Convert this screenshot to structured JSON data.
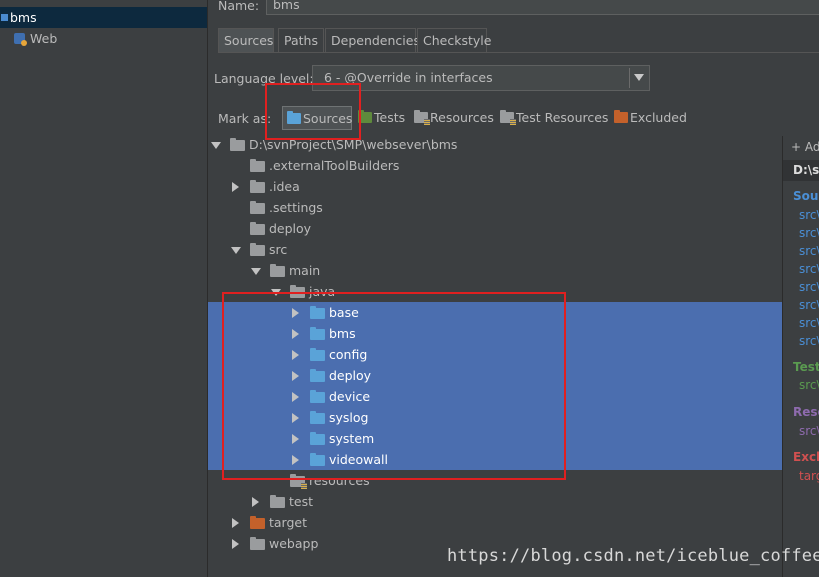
{
  "modules": {
    "items": [
      {
        "label": "bms",
        "selected": true
      },
      {
        "label": "Web",
        "selected": false
      }
    ]
  },
  "header": {
    "name_label": "Name:",
    "name_value": "bms"
  },
  "tabs": [
    {
      "label": "Sources",
      "active": true
    },
    {
      "label": "Paths",
      "active": false
    },
    {
      "label": "Dependencies",
      "active": false
    },
    {
      "label": "Checkstyle",
      "active": false
    }
  ],
  "language": {
    "label": "Language level:",
    "value": "6 - @Override in interfaces"
  },
  "mark_as": {
    "label": "Mark as:",
    "buttons": [
      {
        "label": "Sources",
        "color": "#5aa3d8"
      },
      {
        "label": "Tests",
        "color": "#5e8a3c"
      },
      {
        "label": "Resources",
        "color": "#9a9c9e"
      },
      {
        "label": "Test Resources",
        "color": "#9a9c9e"
      },
      {
        "label": "Excluded",
        "color": "#c4612b"
      }
    ]
  },
  "tree": {
    "root": "D:\\svnProject\\SMP\\websever\\bms",
    "items": [
      {
        "label": ".externalToolBuilders"
      },
      {
        "label": ".idea"
      },
      {
        "label": ".settings"
      },
      {
        "label": "deploy"
      },
      {
        "label": "src"
      },
      {
        "label": "main"
      },
      {
        "label": "java"
      },
      {
        "label": "base"
      },
      {
        "label": "bms"
      },
      {
        "label": "config"
      },
      {
        "label": "deploy"
      },
      {
        "label": "device"
      },
      {
        "label": "syslog"
      },
      {
        "label": "system"
      },
      {
        "label": "videowall"
      },
      {
        "label": "resources"
      },
      {
        "label": "test"
      },
      {
        "label": "target"
      },
      {
        "label": "webapp"
      }
    ]
  },
  "roots": {
    "add": "+ Ad",
    "path": "D:\\sv",
    "sources_title": "Sour",
    "sources": [
      "src\\",
      "src\\",
      "src\\",
      "src\\",
      "src\\",
      "src\\",
      "src\\",
      "src\\"
    ],
    "tests_title": "Test",
    "tests": [
      "src\\"
    ],
    "resources_title": "Reso",
    "resources": [
      "src\\"
    ],
    "excluded_title": "Exclu",
    "excluded": [
      "targ"
    ]
  },
  "colors": {
    "selection": "#4b6eaf",
    "sources": "#4a8fd6",
    "tests": "#5a9a50",
    "resources": "#8e6bae",
    "excluded": "#d05050"
  },
  "watermark": "https://blog.csdn.net/iceblue_coffee"
}
